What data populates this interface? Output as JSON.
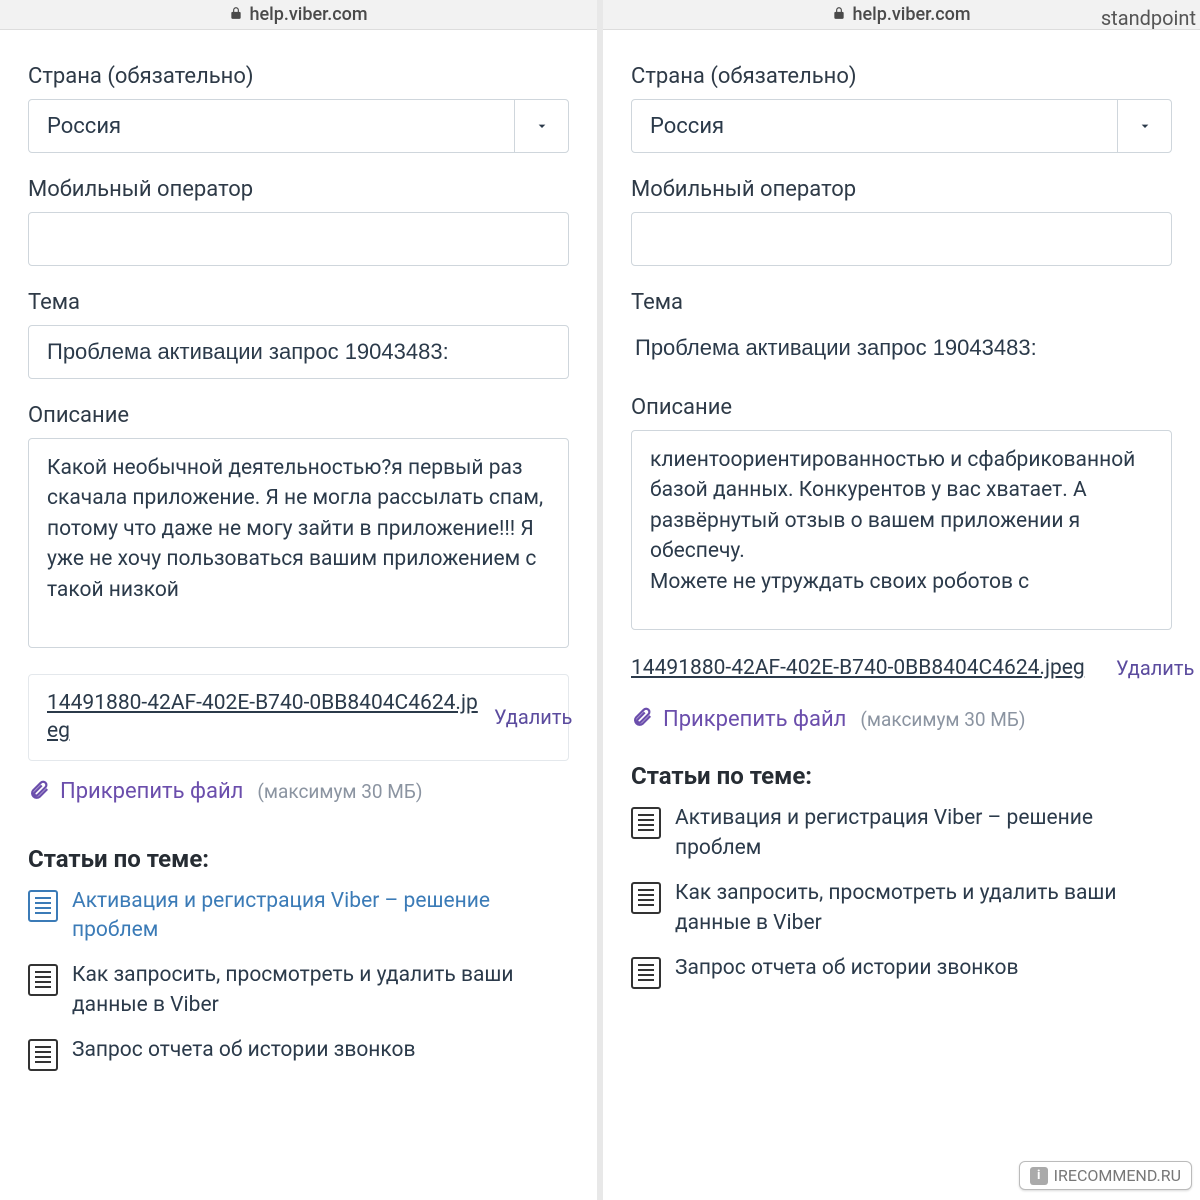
{
  "leftPane": {
    "url": "help.viber.com",
    "country": {
      "label": "Страна (обязательно)",
      "value": "Россия"
    },
    "operator": {
      "label": "Мобильный оператор",
      "value": ""
    },
    "subject": {
      "label": "Тема",
      "value": "Проблема активации запрос 19043483:"
    },
    "description": {
      "label": "Описание",
      "value": "Какой необычной деятельностью?я первый раз скачала приложение. Я не могла рассылать спам, потому что даже не могу зайти в приложение!!! Я уже не хочу пользоваться вашим приложением с такой низкой"
    },
    "attachment": {
      "filename": "14491880-42AF-402E-B740-0BB8404C4624.jpeg",
      "deleteLabel": "Удалить"
    },
    "attach": {
      "link": "Прикрепить файл",
      "hint": "(максимум 30 МБ)"
    },
    "related": {
      "title": "Статьи по теме:",
      "items": [
        "Активация и регистрация Viber – решение проблем",
        "Как запросить, просмотреть и удалить ваши данные в Viber",
        "Запрос отчета об истории звонков"
      ]
    }
  },
  "rightPane": {
    "url": "help.viber.com",
    "country": {
      "label": "Страна (обязательно)",
      "value": "Россия"
    },
    "operator": {
      "label": "Мобильный оператор",
      "value": ""
    },
    "subject": {
      "label": "Тема",
      "value": "Проблема активации запрос 19043483:"
    },
    "description": {
      "label": "Описание",
      "value": "клиентоориентированностью и сфабрикованной базой данных. Конкурентов у вас хватает. А развёрнутый отзыв о вашем приложении я обеспечу.\nМожете не утруждать своих роботов с"
    },
    "attachment": {
      "filename": "14491880-42AF-402E-B740-0BB8404C4624.jpeg",
      "deleteLabel": "Удалить"
    },
    "attach": {
      "link": "Прикрепить файл",
      "hint": "(максимум 30 МБ)"
    },
    "related": {
      "title": "Статьи по теме:",
      "items": [
        "Активация и регистрация Viber – решение проблем",
        "Как запросить, просмотреть и удалить ваши данные в Viber",
        "Запрос отчета об истории звонков"
      ]
    }
  },
  "watermark": {
    "top": "standpoint",
    "bottom": "IRECOMMEND.RU"
  }
}
